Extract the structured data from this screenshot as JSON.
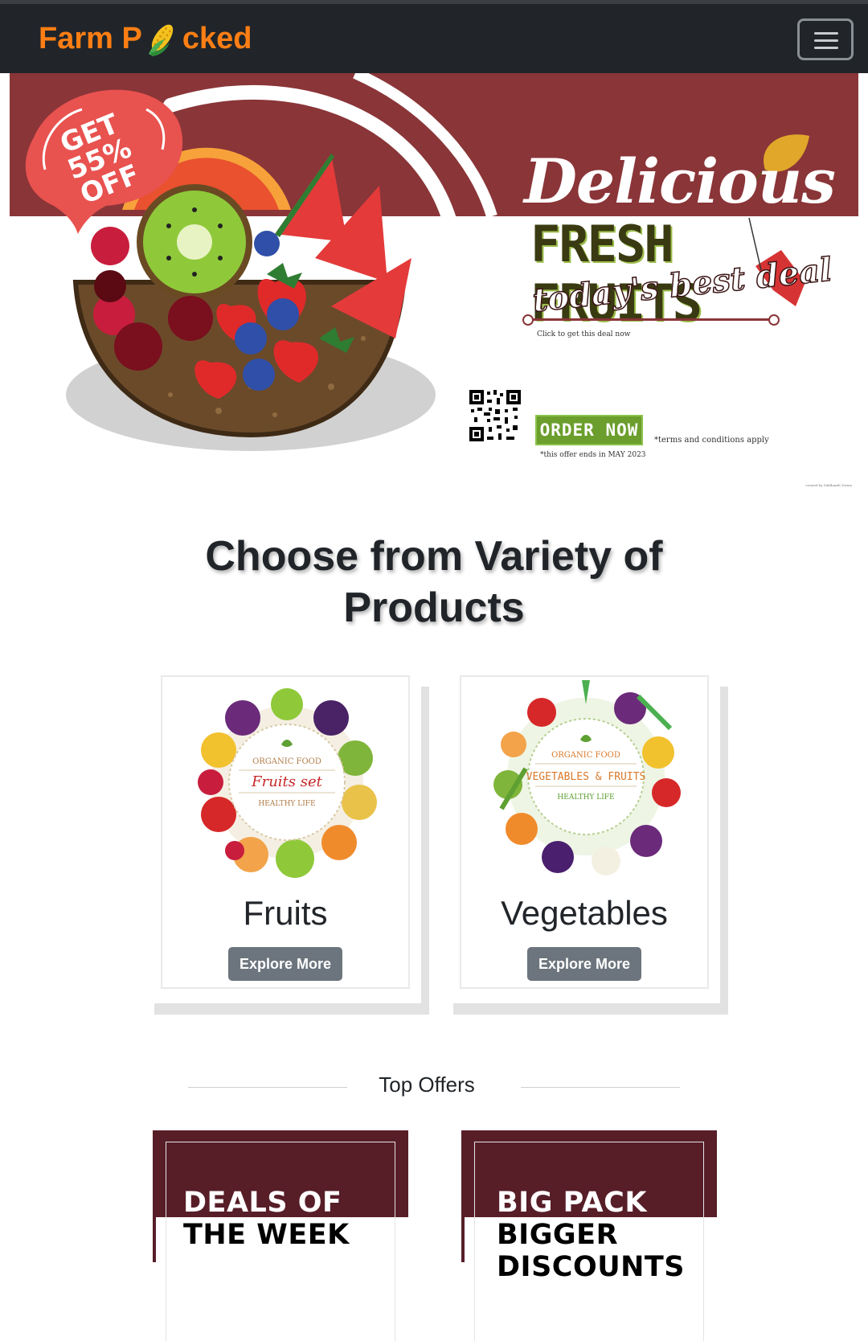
{
  "navbar": {
    "brand_before": "Farm P",
    "brand_after": "cked",
    "brand_icon": "corn-icon",
    "menu_icon": "hamburger-menu-icon",
    "colors": {
      "background": "#212529",
      "brand": "#fd7e14"
    }
  },
  "hero": {
    "badge_line1": "GET 55%",
    "badge_line2": "OFF",
    "headline": "Delicious",
    "subheadline": "FRESH FRUITS",
    "tagline": "today's best deal",
    "click_note": "Click to get this deal now",
    "order_button": "ORDER NOW",
    "terms": "*terms and conditions apply",
    "offer_end": "*this offer ends in MAY 2023",
    "credit": "created by Siddhanth Verma",
    "colors": {
      "band": "#8a3538",
      "badge": "#e8524f",
      "order_button": "#6b9e2c"
    }
  },
  "products_section": {
    "title_line1": "Choose from Variety of",
    "title_line2": "Products",
    "cards": [
      {
        "title": "Fruits",
        "button": "Explore More",
        "image_line1": "ORGANIC FOOD",
        "image_line2": "Fruits set",
        "image_line3": "HEALTHY LIFE"
      },
      {
        "title": "Vegetables",
        "button": "Explore More",
        "image_line1": "ORGANIC FOOD",
        "image_line2": "VEGETABLES & FRUITS",
        "image_line3": "HEALTHY LIFE"
      }
    ]
  },
  "offers_section": {
    "title": "Top Offers",
    "offers": [
      {
        "line1": "DEALS OF",
        "line2": "THE WEEK"
      },
      {
        "line1": "BIG PACK",
        "line2": "BIGGER",
        "line3": "DISCOUNTS"
      }
    ],
    "colors": {
      "band": "#571e28"
    }
  }
}
